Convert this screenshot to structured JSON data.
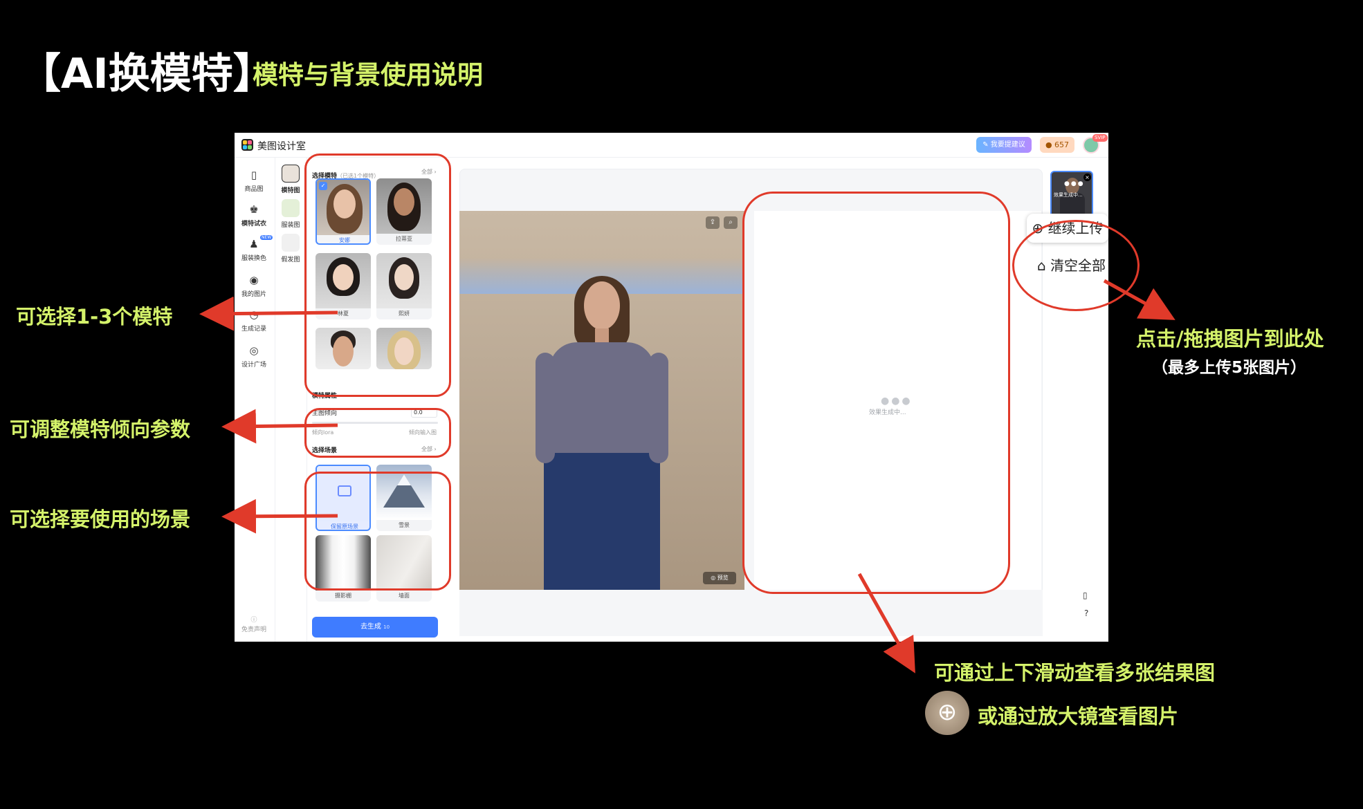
{
  "slide": {
    "title_main": "【AI换模特】",
    "title_sub": "模特与背景使用说明"
  },
  "annotations": {
    "choose_model": "可选择1-3个模特",
    "adjust_params": "可调整模特倾向参数",
    "choose_scene": "可选择要使用的场景",
    "upload_hint": "点击/拖拽图片到此处",
    "upload_limit": "（最多上传5张图片）",
    "scroll_hint": "可通过上下滑动查看多张结果图",
    "zoom_hint": "或通过放大镜查看图片"
  },
  "app": {
    "name": "美图设计室",
    "suggest_label": "我要提建议",
    "credits": "657",
    "svip": "SVIP",
    "nav": [
      {
        "label": "商品图",
        "icon": "product-icon"
      },
      {
        "label": "模特试衣",
        "icon": "model-tryon-icon"
      },
      {
        "label": "服装换色",
        "icon": "clothing-color-icon",
        "badge": "NEW"
      },
      {
        "label": "我的图片",
        "icon": "my-images-icon"
      },
      {
        "label": "生成记录",
        "icon": "history-icon"
      },
      {
        "label": "设计广场",
        "icon": "design-plaza-icon"
      }
    ],
    "disclaimer": "免责声明",
    "subnav": [
      "模特图",
      "服装图",
      "假发图"
    ],
    "model_panel": {
      "title": "选择模特",
      "hint": "（已选1个模特）",
      "all_link": "全部 ›",
      "models": [
        "安娜",
        "拉蒂亚",
        "林夏",
        "熙妍",
        "",
        ""
      ]
    },
    "attributes": {
      "title": "模特属性",
      "slider_label": "主图倾向",
      "slider_value": "0.0",
      "left_label": "倾向lora",
      "right_label": "倾向输入图"
    },
    "scene_panel": {
      "title": "选择场景",
      "all_link": "全部 ›",
      "scenes": [
        "保留原场景",
        "雪景",
        "摄影棚",
        "墙面"
      ]
    },
    "generate_label": "去生成",
    "generate_cost": "10",
    "preview_label": "预览",
    "loading_text": "效果生成中...",
    "thumb_text": "效果生成中...",
    "upload_button": "继续上传",
    "clear_button": "清空全部"
  },
  "colors": {
    "accent": "#3f7cff",
    "annotation": "#d4f26a",
    "highlight_ring": "#e03a2a"
  }
}
